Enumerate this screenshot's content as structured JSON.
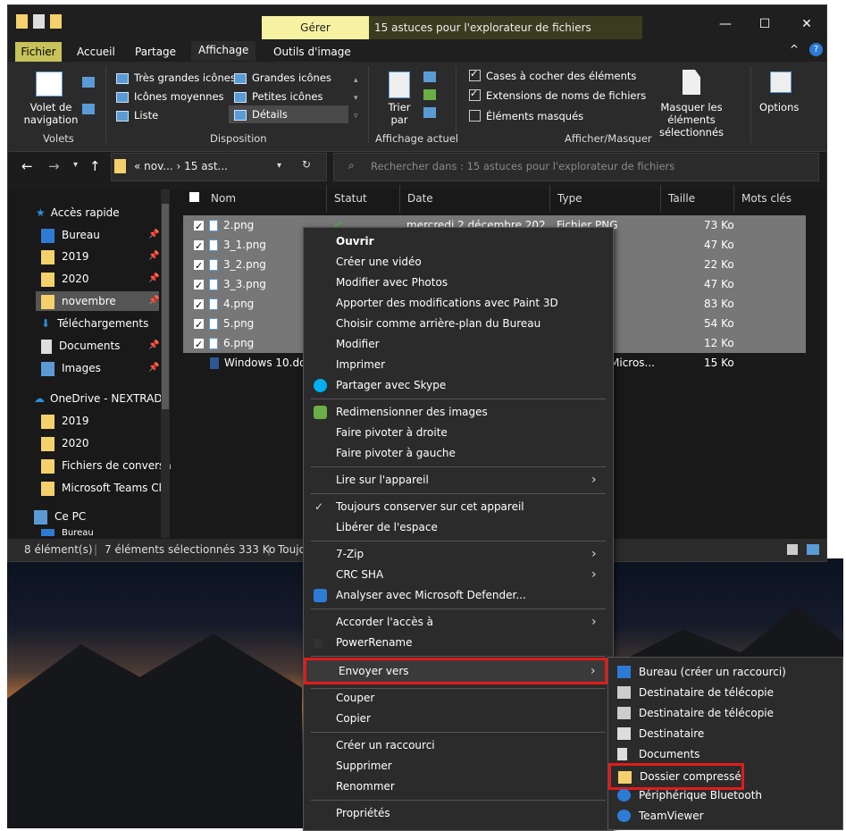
{
  "window": {
    "gerer_label": "Gérer",
    "title": "15 astuces pour l'explorateur de fichiers",
    "controls": {
      "minimize": "—",
      "maximize": "☐",
      "close": "✕"
    }
  },
  "ribbon_tabs": [
    "Fichier",
    "Accueil",
    "Partage",
    "Affichage",
    "Outils d'image"
  ],
  "ribbon": {
    "nav_pane_label": "Volet de navigation",
    "volets_label": "Volets",
    "layout_items": [
      "Très grandes icônes",
      "Grandes icônes",
      "Icônes moyennes",
      "Petites icônes",
      "Liste",
      "Détails"
    ],
    "disposition_label": "Disposition",
    "sort_label": "Trier par",
    "current_view_label": "Affichage actuel",
    "checkboxes": [
      "Cases à cocher des éléments",
      "Extensions de noms de fichiers",
      "Éléments masqués"
    ],
    "hide_selected_label": "Masquer les éléments sélectionnés",
    "show_hide_label": "Afficher/Masquer",
    "options_label": "Options"
  },
  "address": {
    "path": "« nov... › 15 ast...",
    "search_placeholder": "Rechercher dans : 15 astuces pour l'explorateur de fichiers"
  },
  "nav": {
    "quick_access": "Accès rapide",
    "items": [
      "Bureau",
      "2019",
      "2020",
      "novembre",
      "Téléchargements",
      "Documents",
      "Images"
    ],
    "onedrive": "OneDrive - NEXTRADI",
    "onedrive_items": [
      "2019",
      "2020",
      "Fichiers de conversa",
      "Microsoft Teams Ch"
    ],
    "this_pc": "Ce PC",
    "this_pc_child": "Bureau"
  },
  "columns": [
    "Nom",
    "Statut",
    "Date",
    "Type",
    "Taille",
    "Mots clés"
  ],
  "files": [
    {
      "name": "2.png",
      "date": "mercredi 2 décembre 202...",
      "type": "Fichier PNG",
      "size": "73 Ko"
    },
    {
      "name": "3_1.png",
      "size": "47 Ko"
    },
    {
      "name": "3_2.png",
      "size": "22 Ko"
    },
    {
      "name": "3_3.png",
      "size": "47 Ko"
    },
    {
      "name": "4.png",
      "size": "83 Ko"
    },
    {
      "name": "5.png",
      "size": "54 Ko"
    },
    {
      "name": "6.png",
      "size": "12 Ko"
    },
    {
      "name": "Windows 10.do",
      "type": "Micros...",
      "size": "15 Ko"
    }
  ],
  "statusbar": {
    "count": "8 élément(s)",
    "selection": "7 éléments sélectionnés 333 Ko",
    "extra": "Toujo"
  },
  "context_menu": {
    "open": "Ouvrir",
    "items1": [
      "Créer une vidéo",
      "Modifier avec Photos",
      "Apporter des modifications avec Paint 3D",
      "Choisir comme arrière-plan du Bureau",
      "Modifier",
      "Imprimer",
      "Partager avec Skype"
    ],
    "items2": [
      "Redimensionner des images",
      "Faire pivoter à droite",
      "Faire pivoter à gauche"
    ],
    "items3": [
      "Lire sur l'appareil"
    ],
    "items4": [
      "Toujours conserver sur cet appareil",
      "Libérer de l'espace"
    ],
    "items5": [
      "7-Zip",
      "CRC SHA",
      "Analyser avec Microsoft Defender..."
    ],
    "items6": [
      "Accorder l'accès à",
      "PowerRename"
    ],
    "send_to": "Envoyer vers",
    "items7": [
      "Couper",
      "Copier"
    ],
    "items8": [
      "Créer un raccourci",
      "Supprimer",
      "Renommer"
    ],
    "properties": "Propriétés"
  },
  "submenu": {
    "items": [
      "Bureau (créer un raccourci)",
      "Destinataire de télécopie",
      "Destinataire de télécopie",
      "Destinataire",
      "Documents",
      "Dossier compressé",
      "Périphérique Bluetooth",
      "TeamViewer"
    ]
  },
  "colors": {
    "highlight_red": "#e21b1b",
    "selected_row": "#777777",
    "folder": "#f5d16b"
  }
}
